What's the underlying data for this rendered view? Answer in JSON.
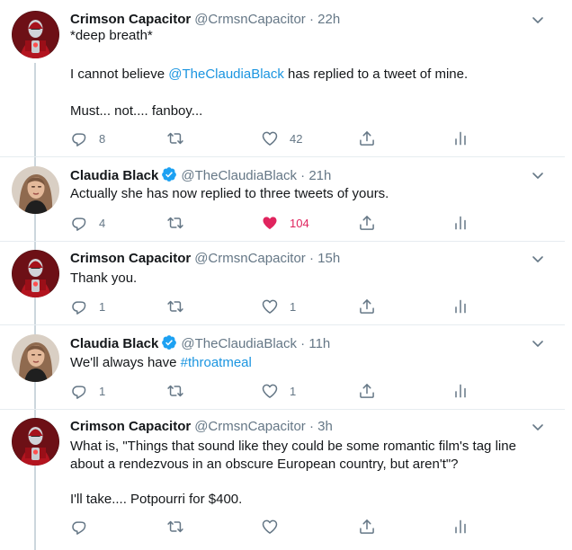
{
  "tweets": [
    {
      "name": "Crimson Capacitor",
      "handle": "@CrmsnCapacitor",
      "dot": "·",
      "time": "22h",
      "verified": false,
      "avatar_icon": "robot-avatar",
      "lines": [
        [
          "*deep breath*"
        ],
        [
          "I cannot believe ",
          {
            "link": "@TheClaudiaBlack"
          },
          " has replied to a tweet of mine."
        ],
        [
          "Must... not.... fanboy..."
        ]
      ],
      "replies": "8",
      "retweets": "",
      "likes": "42",
      "liked": false
    },
    {
      "name": "Claudia Black",
      "handle": "@TheClaudiaBlack",
      "dot": "·",
      "time": "21h",
      "verified": true,
      "avatar_icon": "portrait-avatar",
      "lines": [
        [
          "Actually she has now replied to three tweets of yours."
        ]
      ],
      "replies": "4",
      "retweets": "",
      "likes": "104",
      "liked": true
    },
    {
      "name": "Crimson Capacitor",
      "handle": "@CrmsnCapacitor",
      "dot": "·",
      "time": "15h",
      "verified": false,
      "avatar_icon": "robot-avatar",
      "lines": [
        [
          "Thank you."
        ]
      ],
      "replies": "1",
      "retweets": "",
      "likes": "1",
      "liked": false
    },
    {
      "name": "Claudia Black",
      "handle": "@TheClaudiaBlack",
      "dot": "·",
      "time": "11h",
      "verified": true,
      "avatar_icon": "portrait-avatar",
      "lines": [
        [
          "We'll always have ",
          {
            "link": "#throatmeal"
          }
        ]
      ],
      "replies": "1",
      "retweets": "",
      "likes": "1",
      "liked": false
    },
    {
      "name": "Crimson Capacitor",
      "handle": "@CrmsnCapacitor",
      "dot": "·",
      "time": "3h",
      "verified": false,
      "avatar_icon": "robot-avatar",
      "lines": [
        [
          "What is, \"Things that sound like they could be some romantic film's tag line about a rendezvous in an obscure European country, but aren't\"?"
        ],
        [
          "I'll take.... Potpourri for $400."
        ]
      ],
      "replies": "",
      "retweets": "",
      "likes": "",
      "liked": false
    }
  ],
  "colors": {
    "text": "#14171a",
    "muted": "#657786",
    "link": "#1b95e0",
    "like": "#e0245e",
    "verified": "#1da1f2",
    "divider": "#e6ecf0",
    "thread": "#ccd6dd"
  },
  "icons": {
    "reply": "reply-icon",
    "retweet": "retweet-icon",
    "like": "heart-icon",
    "share": "share-icon",
    "analytics": "analytics-icon",
    "menu": "chevron-down-icon",
    "verified": "verified-badge-icon"
  }
}
